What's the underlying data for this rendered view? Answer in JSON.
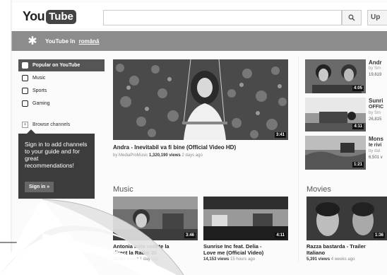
{
  "header": {
    "logo_you": "You",
    "logo_tube": "Tube",
    "search_placeholder": "",
    "upload_label": "Up"
  },
  "banner": {
    "text": "YouTube în",
    "link": "română"
  },
  "sidebar": {
    "items": [
      {
        "label": "Popular on YouTube"
      },
      {
        "label": "Music"
      },
      {
        "label": "Sports"
      },
      {
        "label": "Gaming"
      }
    ],
    "browse_label": "Browse channels",
    "signin_text": "Sign in to add channels to your guide and for great recommendations!",
    "signin_button": "Sign in »"
  },
  "featured": {
    "duration": "3:41",
    "title": "Andra - Inevitabil va fi bine (Official Video HD)",
    "channel": "by MediaProMusic",
    "views": "1,320,190 views",
    "age": "2 days ago"
  },
  "right_videos": [
    {
      "duration": "4:05",
      "title": "Andr",
      "by": "by Sm",
      "views": "19,619"
    },
    {
      "duration": "4:11",
      "title": "Sunri",
      "title2": "OFFIC",
      "by": "by Sm",
      "views": "26,815"
    },
    {
      "duration": "1:21",
      "title": "Mons",
      "title2": "Ie rivi",
      "by": "by dal",
      "views": "6,501 v"
    }
  ],
  "music": {
    "title": "Music",
    "videos": [
      {
        "duration": "3:46",
        "title": "Antonia inita vedete la",
        "title2": "direct la Radio 20",
        "views": "28,961 views",
        "age": "1 day ago"
      },
      {
        "duration": "4:11",
        "title": "Sunrise Inc feat. Delia -",
        "title2": "Love me (Official Video)",
        "views": "14,153 views",
        "age": "15 hours ago"
      }
    ]
  },
  "movies": {
    "title": "Movies",
    "videos": [
      {
        "duration": "1:36",
        "title": "Razza bastarda - Trailer",
        "title2": "Italiano",
        "views": "5,391 views",
        "age": "4 weeks ago"
      }
    ]
  }
}
